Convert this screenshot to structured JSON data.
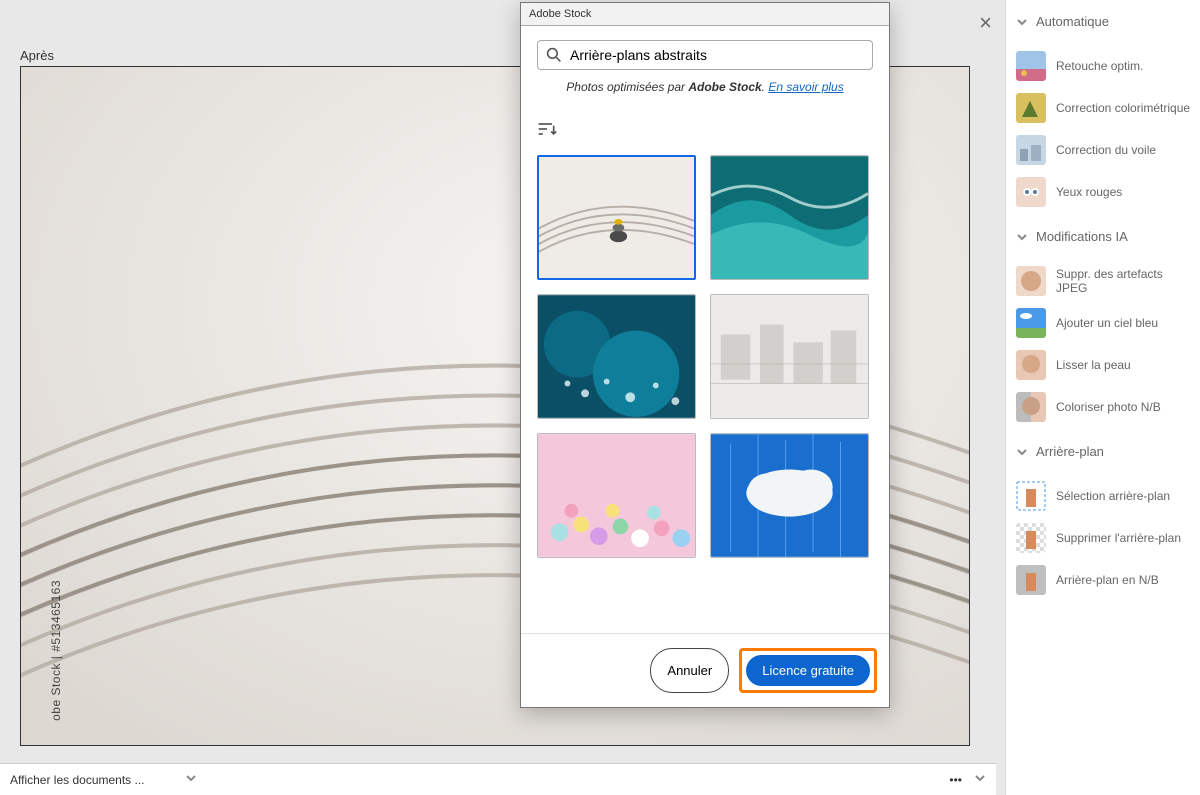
{
  "preview_label": "Après",
  "watermark": "obe Stock | #513465163",
  "close_label": "×",
  "docs_label": "Afficher les documents ...",
  "dots": "•••",
  "modal": {
    "title": "Adobe Stock",
    "search_value": "Arrière-plans abstraits",
    "opt_prefix": "Photos optimisées par ",
    "opt_brand": "Adobe Stock",
    "opt_suffix": ". ",
    "opt_link": "En savoir plus",
    "cancel": "Annuler",
    "license": "Licence gratuite"
  },
  "right": {
    "sections": [
      {
        "title": "Automatique",
        "items": [
          "Retouche optim.",
          "Correction colorimétrique",
          "Correction du voile",
          "Yeux rouges"
        ]
      },
      {
        "title": "Modifications IA",
        "items": [
          "Suppr. des artefacts JPEG",
          "Ajouter un ciel bleu",
          "Lisser la peau",
          "Coloriser photo N/B"
        ]
      },
      {
        "title": "Arrière-plan",
        "items": [
          "Sélection arrière-plan",
          "Supprimer l'arrière-plan",
          "Arrière-plan en N/B"
        ]
      }
    ]
  }
}
